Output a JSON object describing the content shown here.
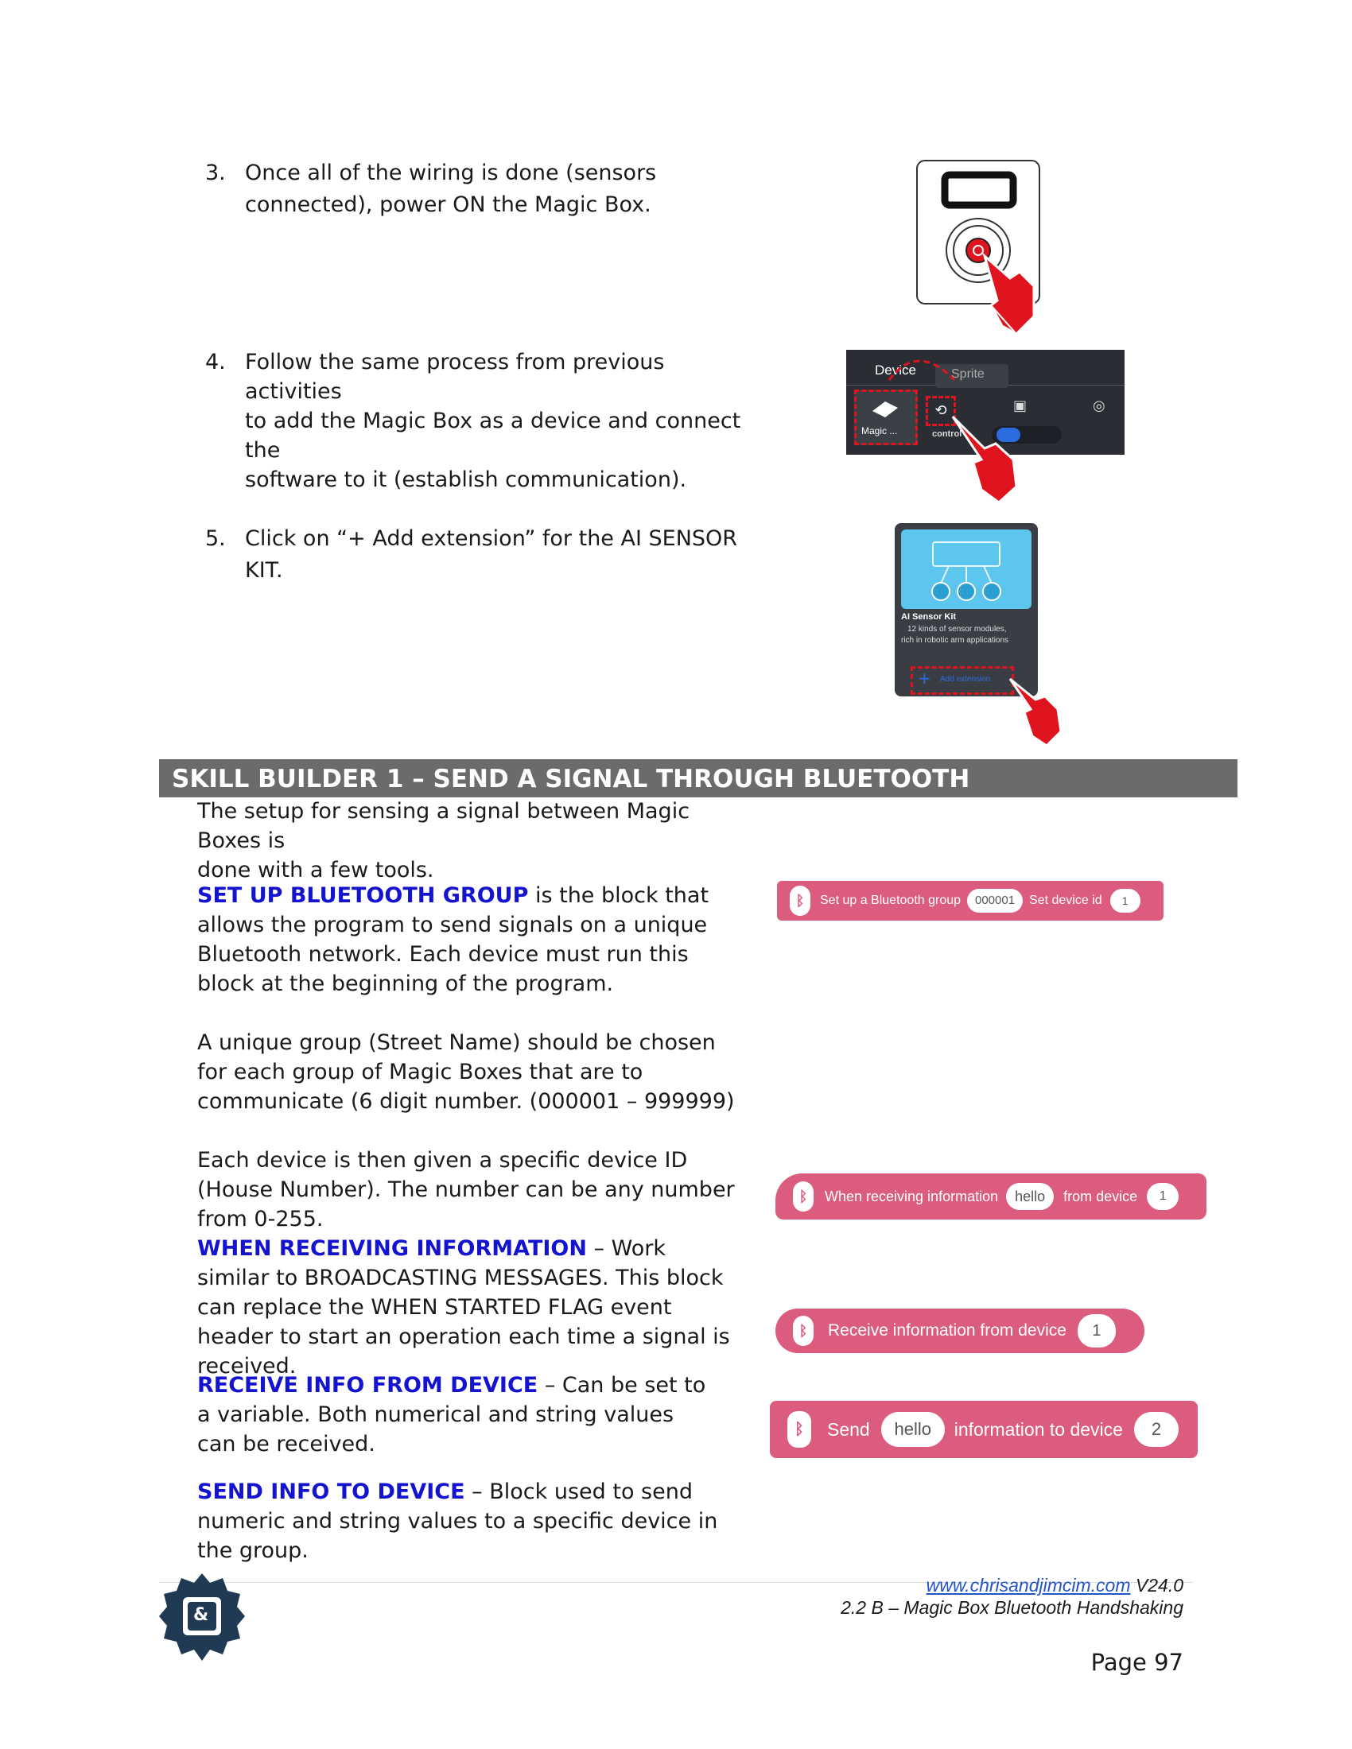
{
  "steps": [
    {
      "num": "3.",
      "lines": [
        "Once all of the wiring is done (sensors",
        "connected), power ON the Magic Box."
      ]
    },
    {
      "num": "4.",
      "lines": [
        "Follow the same process from previous activities",
        "to add the Magic Box as a device and connect the",
        "software to it (establish communication)."
      ]
    },
    {
      "num": "5.",
      "lines": [
        "Click on “+ Add extension” for the AI SENSOR KIT."
      ]
    }
  ],
  "device_panel": {
    "tab_device": "Device",
    "tab_sprite": "Sprite",
    "device_label": "Magic ...",
    "control_label": "control"
  },
  "ext_card": {
    "title": "AI Sensor Kit",
    "desc_line1": "12 kinds of sensor modules,",
    "desc_line2": "rich in robotic arm applications",
    "add_label": "Add extension",
    "plus": "+"
  },
  "banner": "SKILL BUILDER 1 – SEND A SIGNAL THROUGH BLUETOOTH",
  "intro": [
    "The setup for sensing a signal between Magic Boxes is",
    "done with a few tools."
  ],
  "setup": {
    "kw": "SET UP BLUETOOTH GROUP",
    "rest": " is the block that allows the program to send signals on a unique Bluetooth network.  Each device must run this block at the beginning of the program."
  },
  "group_para": "A unique group (Street Name) should be chosen for each group of Magic Boxes that are to communicate (6 digit number. (000001 – 999999)",
  "device_para": "Each device is then given a specific device ID (House Number). The number can be any number from 0-255.",
  "when": {
    "kw": "WHEN RECEIVING INFORMATION",
    "rest": " – Work similar to BROADCASTING MESSAGES.  This block can replace the WHEN STARTED FLAG event header to start an operation each time a signal is received."
  },
  "receive": {
    "kw": "RECEIVE INFO FROM DEVICE",
    "rest": " – Can be set to a variable. Both numerical and string values can be received."
  },
  "send": {
    "kw": "SEND INFO TO DEVICE",
    "rest": " – Block used to send numeric and string values to a specific device in the group."
  },
  "blocks": {
    "setup": {
      "label1": "Set up a Bluetooth group",
      "group": "000001",
      "label2": "Set device id",
      "id": "1"
    },
    "when": {
      "label1": "When receiving information",
      "msg": "hello",
      "label2": "from device",
      "id": "1"
    },
    "receive": {
      "label": "Receive information from device",
      "id": "1"
    },
    "send": {
      "label1": "Send",
      "msg": "hello",
      "label2": "information to device",
      "id": "2"
    }
  },
  "footer": {
    "url": "www.chrisandjimcim.com",
    "version": " V24.0",
    "subtitle": "2.2 B – Magic Box Bluetooth Handshaking",
    "page": "Page 97",
    "logo_text": "&"
  },
  "colors": {
    "accent_blue": "#1414d0",
    "block_pink": "#dc5c7e",
    "banner_gray": "#6b6b6b",
    "pointer_red": "#e0141e"
  }
}
